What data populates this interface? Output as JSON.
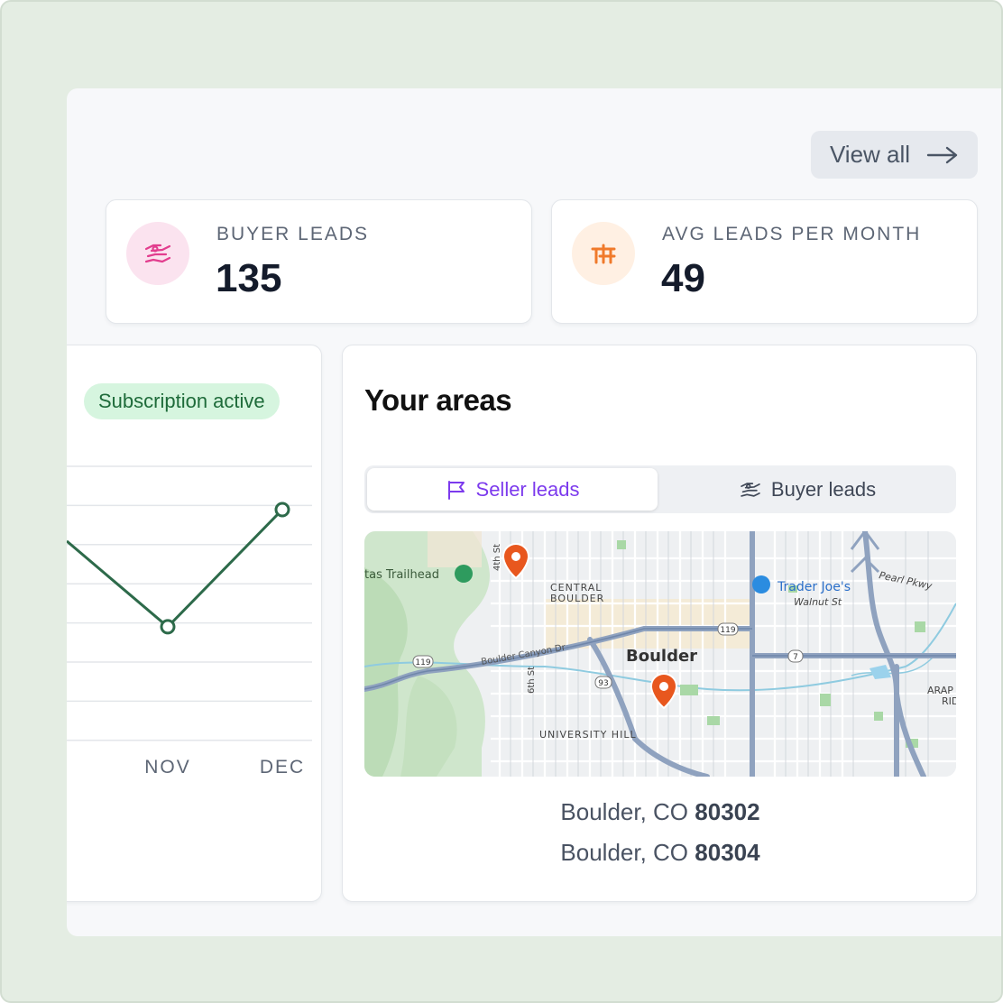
{
  "header": {
    "view_all_label": "View all",
    "view_all_icon": "arrow-right-icon"
  },
  "stats": [
    {
      "label": "BUYER LEADS",
      "value": "135",
      "icon": "buyer-handshake-icon",
      "icon_bg": "#fbe3ef",
      "icon_color": "#e23d8e"
    },
    {
      "label": "AVG LEADS PER MONTH",
      "value": "49",
      "icon": "bar-chart-icon",
      "icon_bg": "#fff0e3",
      "icon_color": "#f07a2b"
    }
  ],
  "subscription": {
    "badge": "Subscription active"
  },
  "chart_data": {
    "type": "line",
    "categories": [
      "NOV",
      "DEC"
    ],
    "series": [
      {
        "values": [
          0.35,
          0.8
        ]
      }
    ],
    "line_color": "#2d6a4a",
    "grid": true
  },
  "areas": {
    "title": "Your areas",
    "tabs": [
      {
        "label": "Seller leads",
        "icon": "flag-icon",
        "active": true
      },
      {
        "label": "Buyer leads",
        "icon": "buyer-handshake-icon",
        "active": false
      }
    ],
    "map": {
      "labels": {
        "trailhead": "tas Trailhead",
        "central_1": "CENTRAL",
        "central_2": "BOULDER",
        "city": "Boulder",
        "trader": "Trader Joe's",
        "walnut": "Walnut St",
        "pearl": "Pearl Pkwy",
        "canyon": "Boulder Canyon Dr",
        "uhill": "UNIVERSITY HILL",
        "fourth": "4th St",
        "sixth": "6th St",
        "r119a": "119",
        "r119b": "119",
        "r93": "93",
        "r7": "7",
        "arap1": "ARAP",
        "arap2": "RID"
      },
      "pin_color": "#e8571e"
    },
    "addresses": [
      {
        "city": "Boulder, CO",
        "zip": "80302"
      },
      {
        "city": "Boulder, CO",
        "zip": "80304"
      }
    ]
  }
}
